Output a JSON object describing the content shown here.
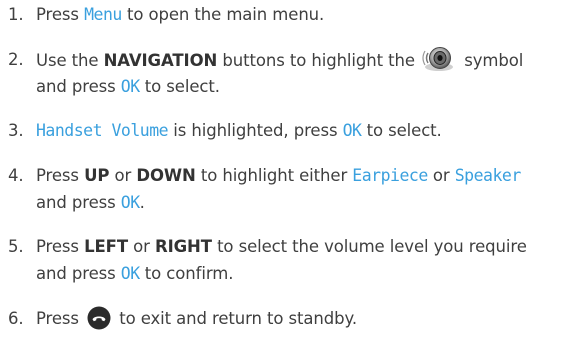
{
  "steps": [
    {
      "n": "1.",
      "a": "Press ",
      "k1": "Menu",
      "b": " to open the main menu."
    },
    {
      "n": "2.",
      "a": "Use the ",
      "k1": "NAVIGATION",
      "b": " buttons to highlight the ",
      "icon": "speaker-volume-icon",
      "c": " symbol",
      "d": "and press ",
      "k2": "OK",
      "e": " to select."
    },
    {
      "n": "3.",
      "k1": "Handset Volume",
      "a": " is highlighted, press ",
      "k2": "OK",
      "b": " to select."
    },
    {
      "n": "4.",
      "a": "Press ",
      "k1": "UP",
      "b": " or ",
      "k2": "DOWN",
      "c": " to highlight either ",
      "k3": "Earpiece",
      "d": " or ",
      "k4": "Speaker",
      "e": "and press ",
      "k5": "OK",
      "f": "."
    },
    {
      "n": "5.",
      "a": "Press ",
      "k1": "LEFT",
      "b": " or ",
      "k2": "RIGHT",
      "c": " to select the volume level you require",
      "d": "and press ",
      "k3": "OK",
      "e": " to confirm."
    },
    {
      "n": "6.",
      "a": "Press ",
      "icon": "end-call-icon",
      "b": " to exit and return to standby."
    }
  ]
}
